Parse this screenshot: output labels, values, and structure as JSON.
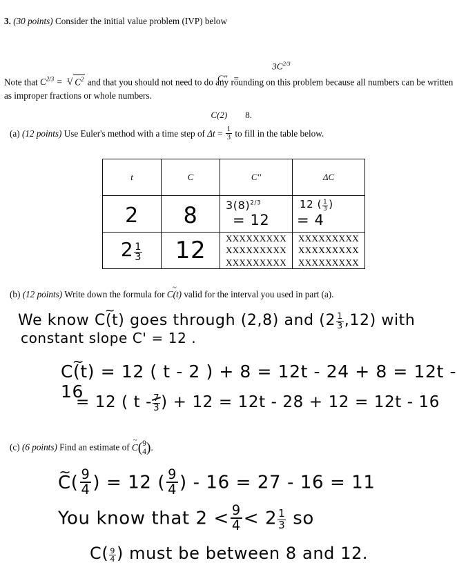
{
  "problem": {
    "number": "3.",
    "points": "(30 points)",
    "stem": "Consider the initial value problem (IVP) below",
    "equation": {
      "lhs_top": "C''",
      "equals": "=",
      "rhs_top_base": "3C",
      "rhs_top_exp": "2/3",
      "lhs_bottom": "C(2)",
      "rhs_bottom": "8."
    },
    "note_part1": "Note that",
    "note_math_lhs_base": "C",
    "note_math_lhs_exp": "2/3",
    "note_math_eq": "=",
    "note_math_root_index": "3",
    "note_math_radicand_base": "C",
    "note_math_radicand_exp": "2",
    "note_part2": "and that you should not need to do any rounding on this problem because all numbers can be written as improper fractions or whole numbers."
  },
  "parts": {
    "a": {
      "label": "(a)",
      "points": "(12 points)",
      "text_before": "Use Euler's method with a time step of",
      "delta_symbol": "Δt",
      "equals": "=",
      "step_num": "1",
      "step_den": "3",
      "text_after": "to fill in the table below."
    },
    "b": {
      "label": "(b)",
      "points": "(12 points)",
      "text_before": "Write down the formula for",
      "function_symbol": "C(t)",
      "text_after": "valid for the interval you used in part (a)."
    },
    "c": {
      "label": "(c)",
      "points": "(6 points)",
      "text_before": "Find an estimate of",
      "function_symbol": "C",
      "arg_num": "9",
      "arg_den": "4",
      "text_after": "."
    }
  },
  "table": {
    "headers": {
      "t": "t",
      "c": "C",
      "cpp": "C''",
      "dc": "ΔC"
    },
    "row1": {
      "t": "2",
      "c": "8",
      "cpp_line1_base": "3(8)",
      "cpp_line1_exp": "2/3",
      "cpp_line2": "= 12",
      "dc_line1_lead": "12 (",
      "dc_line1_num": "1",
      "dc_line1_den": "3",
      "dc_line1_tail": ")",
      "dc_line2": "= 4"
    },
    "row2": {
      "t_whole": "2",
      "t_num": "1",
      "t_den": "3",
      "c": "12",
      "cpp_blocked": [
        "XXXXXXXXX",
        "XXXXXXXXX",
        "XXXXXXXXX"
      ],
      "dc_blocked": [
        "XXXXXXXXX",
        "XXXXXXXXX",
        "XXXXXXXXX"
      ]
    }
  },
  "handwriting": {
    "b_line1_a": "We know",
    "b_line1_c": "C(t)",
    "b_line1_b": "goes through (2,8) and (2",
    "b_line1_frac_num": "1",
    "b_line1_frac_den": "3",
    "b_line1_d": ",12) with",
    "b_line2": "constant slope   C' = 12 .",
    "b_line3_fn": "C(t)",
    "b_line3_rest": "= 12 ( t - 2 ) + 8   =  12t - 24 + 8  =  12t - 16",
    "b_line4_lead": "= 12 ( t -",
    "b_line4_num": "7",
    "b_line4_den": "3",
    "b_line4_rest": ") + 12   =  12t - 28 + 12  =  12t - 16",
    "c_line1_fn": "C",
    "c_line1_num": "9",
    "c_line1_den": "4",
    "c_line1_mid": ") = 12 (",
    "c_line1_num2": "9",
    "c_line1_den2": "4",
    "c_line1_tail": ") - 16  =   27 - 16 = 11",
    "c_line2_lead": "You know that   2 <",
    "c_line2_num": "9",
    "c_line2_den": "4",
    "c_line2_mid": "< 2",
    "c_line2_num2": "1",
    "c_line2_den2": "3",
    "c_line2_tail": "so",
    "c_line3_fn": "C",
    "c_line3_num": "9",
    "c_line3_den": "4",
    "c_line3_tail": ")   must   be   between   8 and 12."
  }
}
